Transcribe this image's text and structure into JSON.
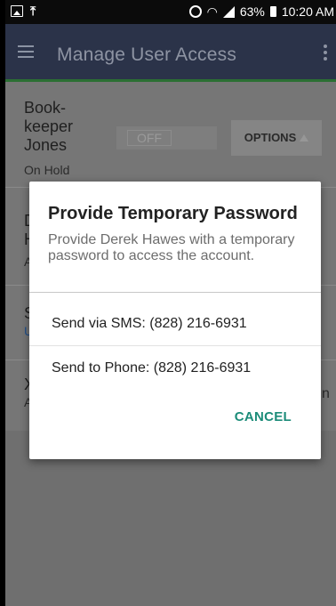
{
  "status_bar": {
    "battery_text": "63%",
    "time": "10:20 AM",
    "left_icons": [
      "image-icon",
      "upload-icon"
    ],
    "right_icons": [
      "alarm-icon",
      "wifi-icon",
      "signal-icon",
      "battery-icon"
    ]
  },
  "app_bar": {
    "title": "Manage User Access",
    "colors": {
      "background": "#2b3349",
      "accent_line": "#2b6f33"
    }
  },
  "users": [
    {
      "name_lines": [
        "Book-",
        "keeper",
        "Jones"
      ],
      "status": "On Hold",
      "toggle": "OFF",
      "options_label": "OPTIONS"
    },
    {
      "name_lines": [
        "D",
        "H"
      ],
      "status": "A"
    },
    {
      "name_lines": [
        "S"
      ],
      "status": "U"
    },
    {
      "name_lines": [
        "X"
      ],
      "status": "A",
      "trailing": "n"
    }
  ],
  "dialog": {
    "title": "Provide Temporary Password",
    "message": "Provide Derek Hawes with a temporary password to access the account.",
    "options": [
      "Send via SMS: (828) 216-6931",
      "Send to Phone: (828) 216-6931"
    ],
    "cancel_label": "CANCEL",
    "colors": {
      "cancel": "#1c8c79"
    }
  }
}
